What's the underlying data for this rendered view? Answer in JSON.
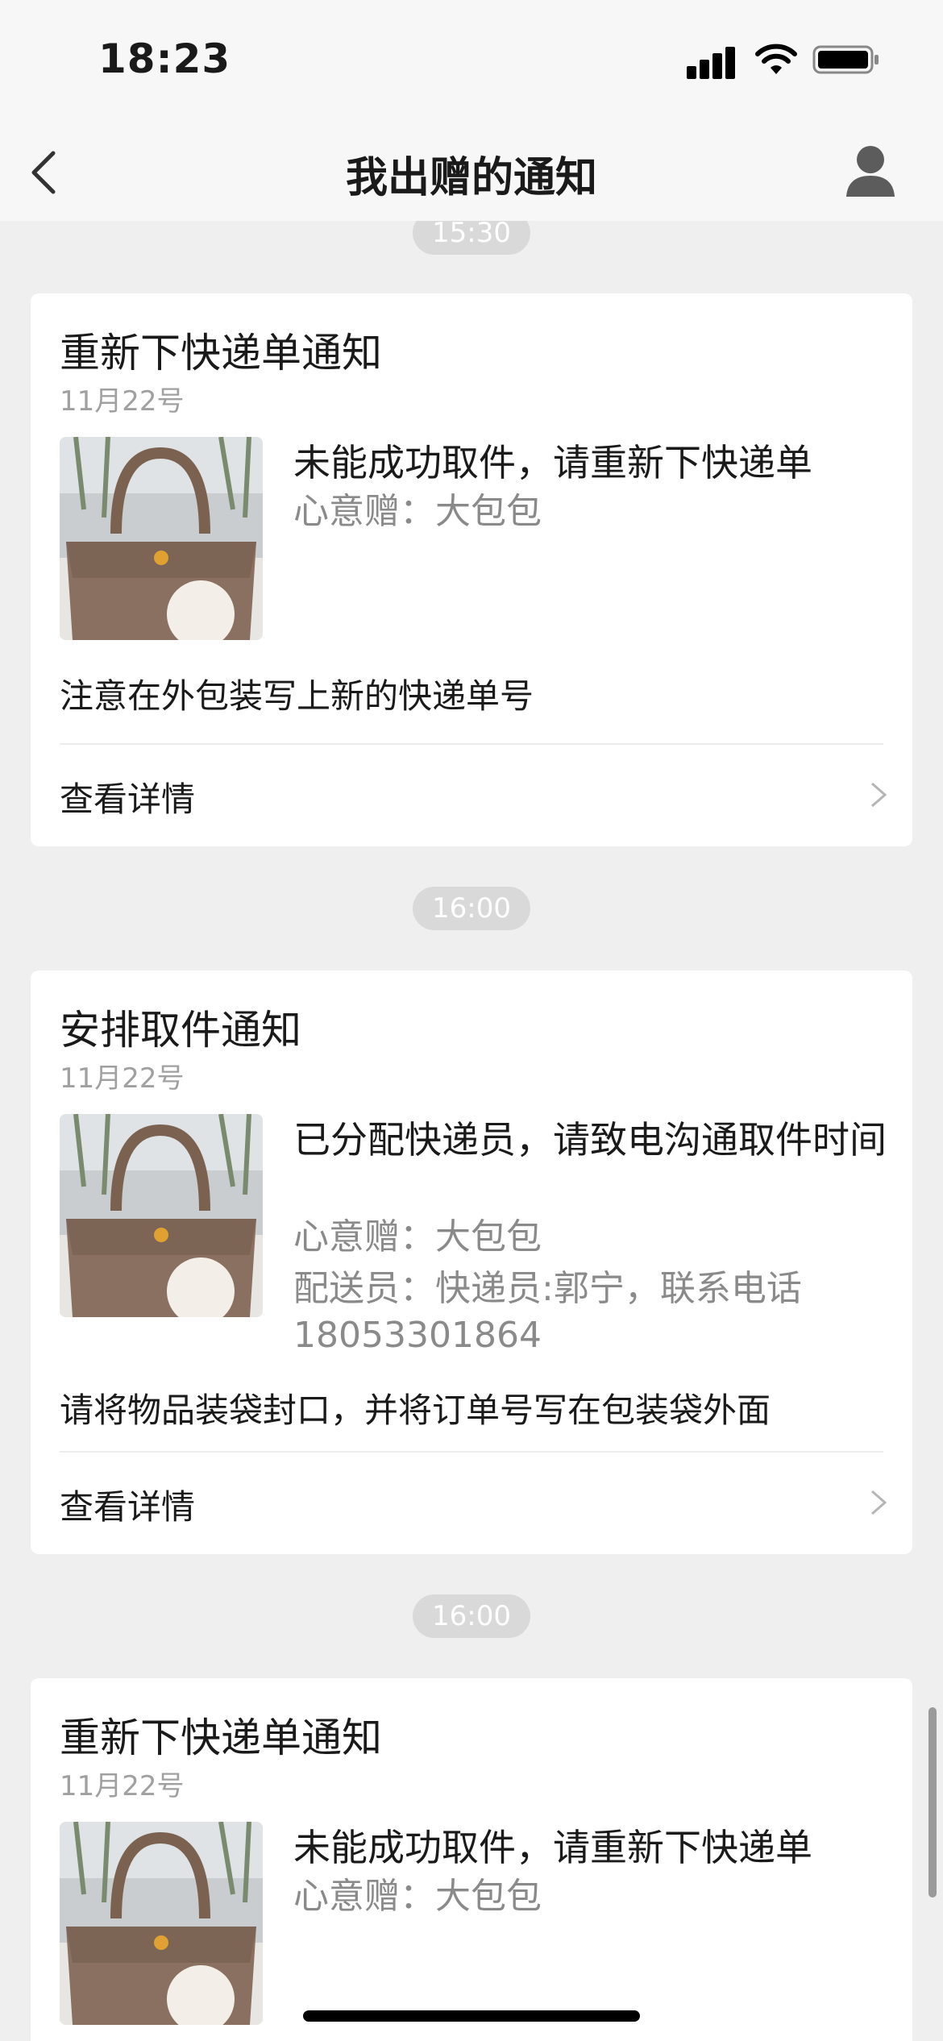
{
  "status_bar": {
    "time": "18:23"
  },
  "nav": {
    "title": "我出赠的通知"
  },
  "timeline": [
    {
      "time": "15:30"
    },
    {
      "time": "16:00"
    },
    {
      "time": "16:00"
    }
  ],
  "cards": [
    {
      "title": "重新下快递单通知",
      "date": "11月22号",
      "headline": "未能成功取件，请重新下快递单",
      "gift_line": "心意赠：大包包",
      "note": "注意在外包装写上新的快递单号",
      "detail_label": "查看详情"
    },
    {
      "title": "安排取件通知",
      "date": "11月22号",
      "headline": "已分配快递员，请致电沟通取件时间",
      "gift_line": "心意赠：大包包",
      "courier_line": "配送员：快递员:郭宁，联系电话18053301864",
      "note": "请将物品装袋封口，并将订单号写在包装袋外面",
      "detail_label": "查看详情"
    },
    {
      "title": "重新下快递单通知",
      "date": "11月22号",
      "headline": "未能成功取件，请重新下快递单",
      "gift_line": "心意赠：大包包"
    }
  ],
  "colors": {
    "background": "#efefef",
    "card": "#ffffff",
    "pill": "#d9d9d9",
    "muted": "#8a8a8a"
  },
  "icons": [
    "back-chevron-icon",
    "profile-icon",
    "signal-icon",
    "wifi-icon",
    "battery-icon",
    "chevron-right-icon"
  ]
}
